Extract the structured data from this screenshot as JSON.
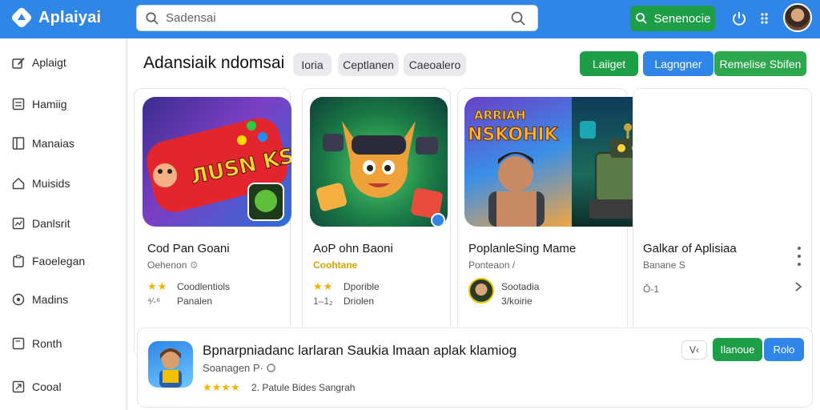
{
  "app": {
    "name": "Aplaiyai"
  },
  "search": {
    "value": "Sadensai"
  },
  "header": {
    "action_label": "Senenocie"
  },
  "colors": {
    "topbar": "#2f86e6",
    "green": "#1f9e48",
    "blue": "#2f86e6",
    "star": "#f2b400"
  },
  "sidebar": {
    "items": [
      {
        "label": "Aplaigt",
        "icon": "edit-icon"
      },
      {
        "label": "Hamiig",
        "icon": "list-icon"
      },
      {
        "label": "Manaias",
        "icon": "book-icon"
      },
      {
        "label": "Muisids",
        "icon": "home-icon"
      },
      {
        "label": "Danlsrit",
        "icon": "chart-icon"
      },
      {
        "label": "Faoelegan",
        "icon": "clipboard-icon"
      },
      {
        "label": "Madins",
        "icon": "target-icon"
      },
      {
        "label": "Ronth",
        "icon": "document-icon"
      },
      {
        "label": "Cooal",
        "icon": "export-icon"
      }
    ]
  },
  "main": {
    "title": "Adansiaik ndomsai",
    "chips": [
      "Ioria",
      "Ceptlanen",
      "Caeoalero"
    ],
    "actions": [
      "Laiiget",
      "Lagngner",
      "Remelise Sbifen"
    ]
  },
  "cards": [
    {
      "name": "Cod Pan Goani",
      "subtitle": "Oehenon",
      "rating": "★★",
      "meta1": "Coodlentiols",
      "meta2_prefix": "⁴⁄-⁶",
      "meta2": "Panalen"
    },
    {
      "name": "AoP ohn Baoni",
      "subtitle": "Coohtane",
      "rating": "★★",
      "meta1": "Dporible",
      "meta2_prefix": "1–1₂",
      "meta2": "Driolen"
    },
    {
      "name": "PoplanleSing Mame",
      "subtitle": "Ponteaon /",
      "dev": "Sootadia",
      "dev_sub": "3/koirie"
    },
    {
      "name": "Galkar of Aplisiaa",
      "subtitle": "Banane S",
      "meta": "Ŏ-1"
    }
  ],
  "art": {
    "card1_text": "ЛUSN KSIHI",
    "card3_text1": "ARRIAH",
    "card3_text2": "NSKOHIK"
  },
  "featured": {
    "title": "Bpnarpniadanc larlaran Saukia lmaan aplak klamiog",
    "subtitle": "Soanagen",
    "subtitle_extra": "P·",
    "stars": "★★★★",
    "meta": "2. Patule Bides Sangrah",
    "badge": "V‹",
    "btn_install": "Ilanoue",
    "btn_more": "Rolo"
  }
}
